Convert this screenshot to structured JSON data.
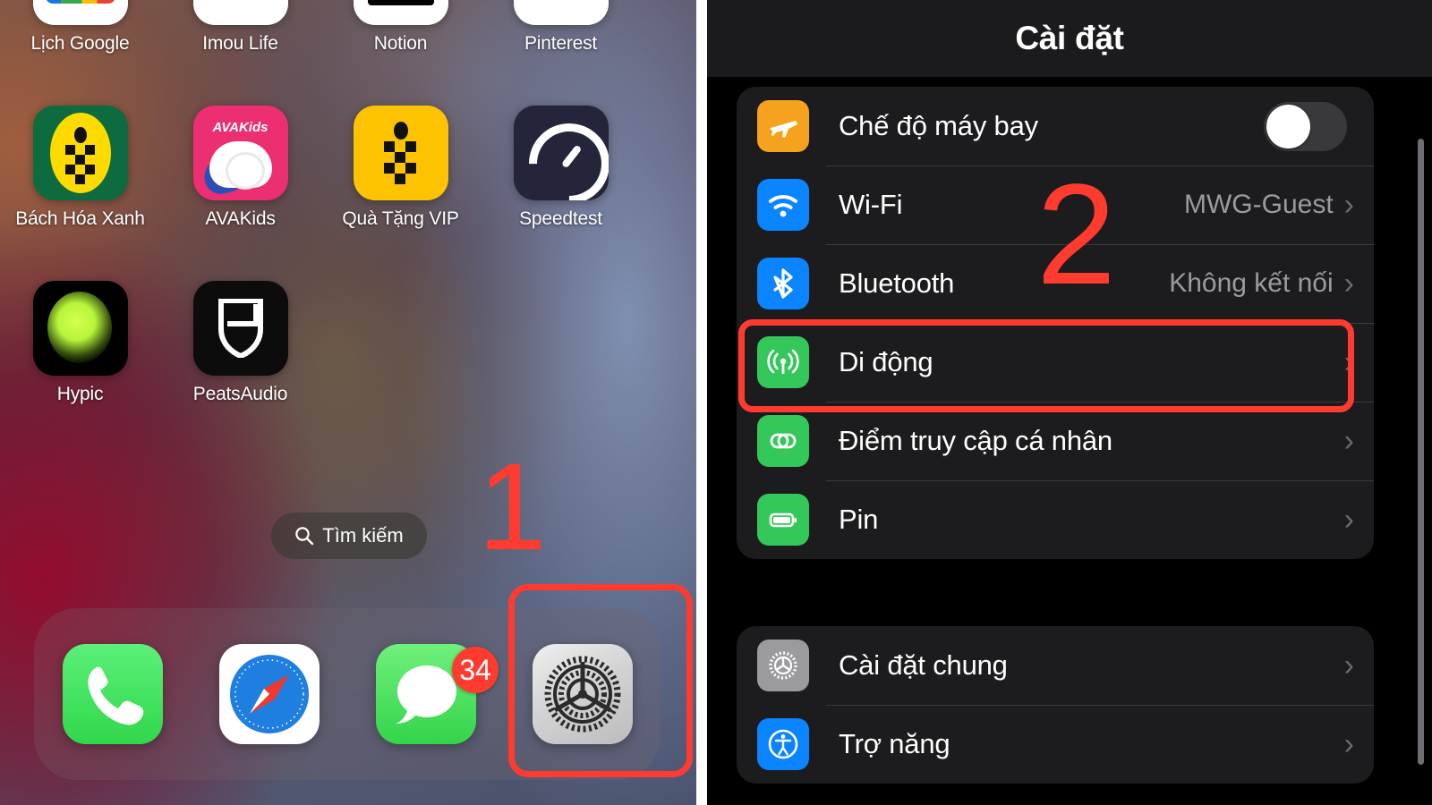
{
  "home": {
    "apps_rows": [
      [
        {
          "label": "Lịch Google",
          "icon": "google-calendar-icon"
        },
        {
          "label": "Imou Life",
          "icon": "imou-life-icon"
        },
        {
          "label": "Notion",
          "icon": "notion-icon"
        },
        {
          "label": "Pinterest",
          "icon": "pinterest-icon"
        }
      ],
      [
        {
          "label": "Bách Hóa Xanh",
          "icon": "bach-hoa-xanh-icon"
        },
        {
          "label": "AVAKids",
          "icon": "avakids-icon"
        },
        {
          "label": "Quà Tặng VIP",
          "icon": "qua-tang-vip-icon"
        },
        {
          "label": "Speedtest",
          "icon": "speedtest-icon"
        }
      ],
      [
        {
          "label": "Hypic",
          "icon": "hypic-icon"
        },
        {
          "label": "PeatsAudio",
          "icon": "peatsaudio-icon"
        }
      ]
    ],
    "search": {
      "label": "Tìm kiếm",
      "icon": "search-icon"
    },
    "dock": [
      {
        "name": "phone-app",
        "icon": "phone-icon",
        "badge": ""
      },
      {
        "name": "safari-app",
        "icon": "safari-compass-icon",
        "badge": ""
      },
      {
        "name": "messages-app",
        "icon": "messages-bubble-icon",
        "badge": "34"
      },
      {
        "name": "settings-app",
        "icon": "settings-gear-icon",
        "badge": ""
      }
    ],
    "annotation_step": "1"
  },
  "settings": {
    "title": "Cài đặt",
    "annotation_step": "2",
    "groups": [
      {
        "id": "connectivity",
        "rows": [
          {
            "label": "Chế độ máy bay",
            "icon": "airplane-icon",
            "icon_color": "#f5a21e",
            "control": "toggle",
            "toggle_on": false,
            "value": ""
          },
          {
            "label": "Wi-Fi",
            "icon": "wifi-icon",
            "icon_color": "#0a84ff",
            "control": "chevron",
            "value": "MWG-Guest"
          },
          {
            "label": "Bluetooth",
            "icon": "bluetooth-icon",
            "icon_color": "#0a84ff",
            "control": "chevron",
            "value": "Không kết nối"
          },
          {
            "label": "Di động",
            "icon": "cellular-antenna-icon",
            "icon_color": "#34c759",
            "control": "chevron",
            "value": "",
            "highlighted": true
          },
          {
            "label": "Điểm truy cập cá nhân",
            "icon": "personal-hotspot-icon",
            "icon_color": "#34c759",
            "control": "chevron",
            "value": ""
          },
          {
            "label": "Pin",
            "icon": "battery-icon",
            "icon_color": "#34c759",
            "control": "chevron",
            "value": ""
          }
        ]
      },
      {
        "id": "general",
        "rows": [
          {
            "label": "Cài đặt chung",
            "icon": "gear-icon",
            "icon_color": "#9b9b9f",
            "control": "chevron",
            "value": ""
          },
          {
            "label": "Trợ năng",
            "icon": "accessibility-icon",
            "icon_color": "#0a84ff",
            "control": "chevron",
            "value": ""
          }
        ]
      }
    ],
    "chevron_glyph": "›"
  },
  "colors": {
    "annotation_red": "#ff3b30",
    "card_bg": "#1c1c1e",
    "panel_bg": "#000000",
    "separator": "#3a3a3c",
    "secondary_text": "#9b9b9f"
  }
}
